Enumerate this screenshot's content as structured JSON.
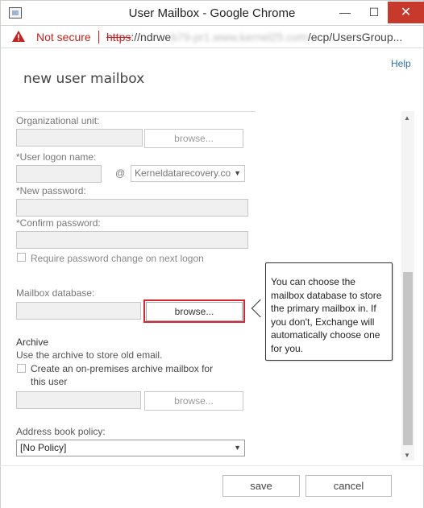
{
  "window": {
    "title": "User Mailbox - Google Chrome",
    "minimize_glyph": "—",
    "maximize_glyph": "☐",
    "close_glyph": "✕"
  },
  "addressbar": {
    "security_label": "Not secure",
    "url_protocol": "https",
    "url_host_visible": "://ndrwe",
    "url_host_blurred": "b79-pr1.www.kernel25.com",
    "url_path": "/ecp/UsersGroup..."
  },
  "page": {
    "help_label": "Help",
    "title": "new user mailbox"
  },
  "form": {
    "org_unit_label": "Organizational unit:",
    "browse_label": "browse...",
    "logon_name_label": "*User logon name:",
    "at_sign": "@",
    "domain_value": "Kerneldatarecovery.co",
    "new_password_label": "*New password:",
    "confirm_password_label": "*Confirm password:",
    "require_change_label": "Require password change on next logon",
    "mailbox_db_label": "Mailbox database:",
    "mailbox_browse_label": "browse...",
    "archive_heading": "Archive",
    "archive_description": "Use the archive to store old email.",
    "archive_checkbox_line1": "Create an on-premises archive mailbox for",
    "archive_checkbox_line2": "this user",
    "archive_browse_label": "browse...",
    "address_book_label": "Address book policy:",
    "address_book_value": "[No Policy]"
  },
  "tooltip": {
    "text": "You can choose the mailbox database to store the primary mailbox in. If you don't, Exchange will automatically choose one for you."
  },
  "footer": {
    "save_label": "save",
    "cancel_label": "cancel"
  },
  "colors": {
    "warning": "#c5221f",
    "highlight": "#d9232e",
    "link": "#2a6ebb",
    "close_button": "#c7392b"
  },
  "icons": {
    "app": "window-app-icon",
    "warning": "warning-triangle-icon",
    "dropdown": "chevron-down-icon",
    "scroll_up": "scroll-up-arrow-icon",
    "scroll_down": "scroll-down-arrow-icon"
  }
}
